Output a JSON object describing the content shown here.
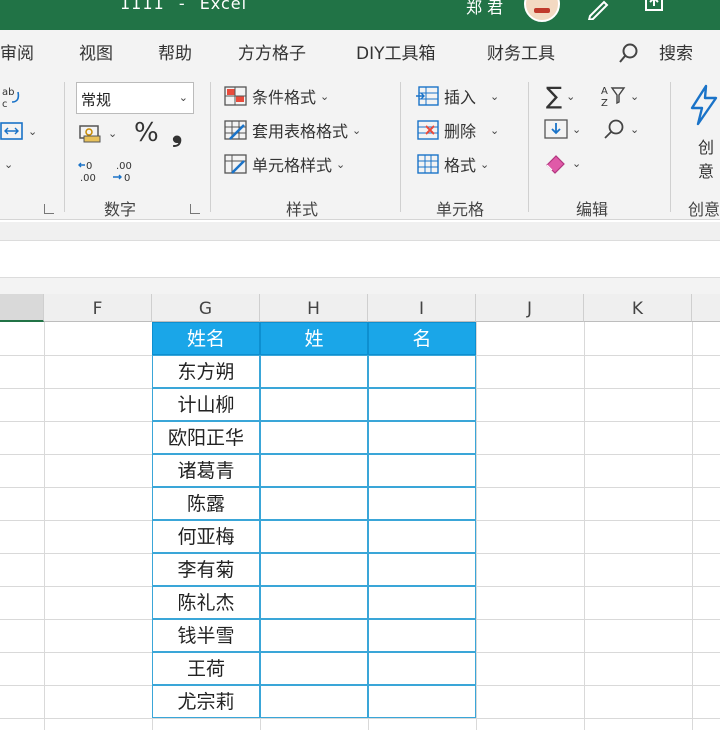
{
  "titlebar": {
    "file_name": "1111",
    "separator": "-",
    "app_name": "Excel",
    "user_name": "郑 君"
  },
  "tabs": [
    {
      "label": "审阅"
    },
    {
      "label": "视图"
    },
    {
      "label": "帮助"
    },
    {
      "label": "方方格子"
    },
    {
      "label": "DIY工具箱"
    },
    {
      "label": "财务工具"
    },
    {
      "label": "搜索"
    }
  ],
  "ribbon": {
    "number_format_value": "常规",
    "percent_symbol": "%",
    "comma_symbol": "❟",
    "increase_decimal": "←0 .00",
    "decrease_decimal": ".00 →0",
    "styles": {
      "conditional_format": "条件格式",
      "format_as_table": "套用表格格式",
      "cell_styles": "单元格样式"
    },
    "cells": {
      "insert": "插入",
      "delete": "删除",
      "format": "格式"
    },
    "editing": {
      "sum_symbol": "∑"
    },
    "ideas_label_line1": "创",
    "ideas_label_line2": "意",
    "group_labels": {
      "number": "数字",
      "styles": "样式",
      "cells": "单元格",
      "editing": "编辑",
      "ideas": "创意"
    }
  },
  "columns": [
    "F",
    "G",
    "H",
    "I",
    "J",
    "K"
  ],
  "table": {
    "headers": [
      "姓名",
      "姓",
      "名"
    ],
    "names": [
      "东方朔",
      "计山柳",
      "欧阳正华",
      "诸葛青",
      "陈露",
      "何亚梅",
      "李有菊",
      "陈礼杰",
      "钱半雪",
      "王荷",
      "尤宗莉"
    ]
  },
  "colors": {
    "excel_green": "#217346",
    "header_fill": "#1aa6e8",
    "table_border": "#3aa6d8"
  }
}
